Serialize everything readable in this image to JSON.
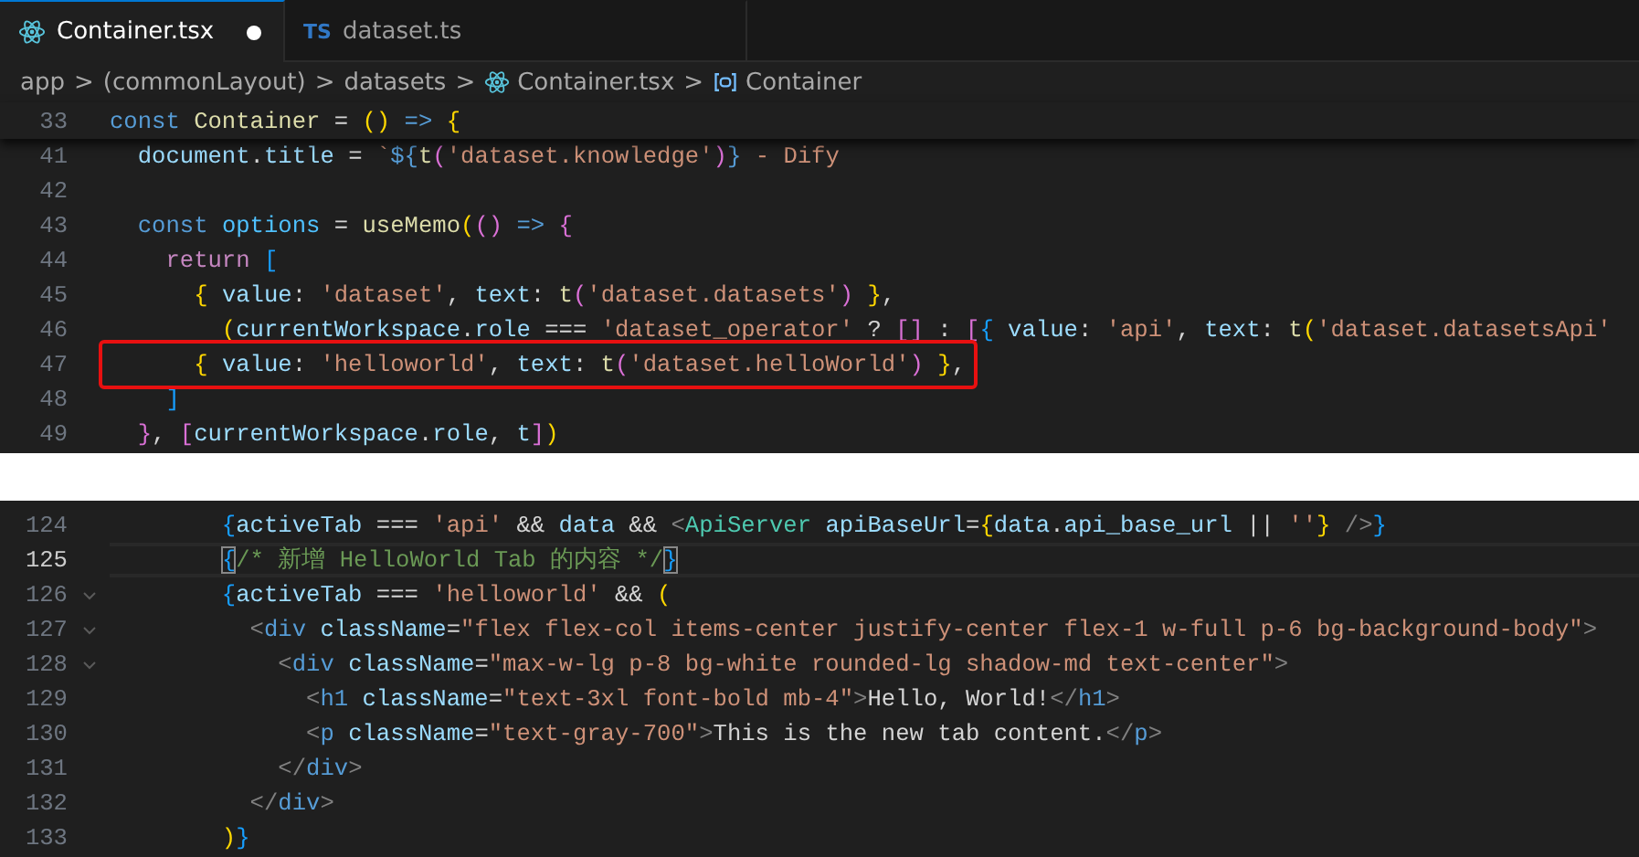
{
  "tabs": [
    {
      "kind": "tsx",
      "label": "Container.tsx",
      "selected": true,
      "modified": true
    },
    {
      "kind": "ts",
      "badge": "TS",
      "label": "dataset.ts",
      "selected": false,
      "modified": false
    }
  ],
  "breadcrumb": [
    {
      "kind": "folder",
      "label": "app"
    },
    {
      "kind": "folder",
      "sep": ">",
      "label": "(commonLayout)"
    },
    {
      "kind": "folder",
      "sep": ">",
      "label": "datasets"
    },
    {
      "kind": "file",
      "sep": ">",
      "label": "Container.tsx"
    },
    {
      "kind": "symbol",
      "sep": ">",
      "label": "Container"
    }
  ],
  "sticky_line": {
    "number": "33",
    "tokens": [
      {
        "kind": "kw",
        "text": "const "
      },
      {
        "kind": "fn",
        "text": "Container"
      },
      {
        "kind": "p",
        "text": " = "
      },
      {
        "kind": "b1",
        "text": "()"
      },
      {
        "kind": "kw",
        "text": " => "
      },
      {
        "kind": "b1",
        "text": "{"
      }
    ]
  },
  "editor_top": {
    "lines": [
      {
        "number": "41",
        "tokens": [
          {
            "kind": "var",
            "text": "  document"
          },
          {
            "kind": "p",
            "text": "."
          },
          {
            "kind": "var",
            "text": "title"
          },
          {
            "kind": "p",
            "text": " = "
          },
          {
            "kind": "str",
            "text": "`"
          },
          {
            "kind": "kw",
            "text": "${"
          },
          {
            "kind": "fn",
            "text": "t"
          },
          {
            "kind": "b2",
            "text": "("
          },
          {
            "kind": "str",
            "text": "'dataset.knowledge'"
          },
          {
            "kind": "b2",
            "text": ")"
          },
          {
            "kind": "kw",
            "text": "}"
          },
          {
            "kind": "str",
            "text": " - Dify"
          }
        ]
      },
      {
        "number": "42"
      },
      {
        "number": "43",
        "tokens": [
          {
            "kind": "kw",
            "text": "  const "
          },
          {
            "kind": "const",
            "text": "options"
          },
          {
            "kind": "p",
            "text": " = "
          },
          {
            "kind": "fn",
            "text": "useMemo"
          },
          {
            "kind": "b1",
            "text": "("
          },
          {
            "kind": "b2",
            "text": "()"
          },
          {
            "kind": "kw",
            "text": " => "
          },
          {
            "kind": "b2",
            "text": "{"
          }
        ]
      },
      {
        "number": "44",
        "tokens": [
          {
            "kind": "ctl",
            "text": "    return "
          },
          {
            "kind": "b3",
            "text": "["
          }
        ]
      },
      {
        "number": "45",
        "tokens": [
          {
            "kind": "b1",
            "text": "      {"
          },
          {
            "kind": "var",
            "text": " value"
          },
          {
            "kind": "p",
            "text": ": "
          },
          {
            "kind": "str",
            "text": "'dataset'"
          },
          {
            "kind": "p",
            "text": ", "
          },
          {
            "kind": "var",
            "text": "text"
          },
          {
            "kind": "p",
            "text": ": "
          },
          {
            "kind": "fn",
            "text": "t"
          },
          {
            "kind": "b2",
            "text": "("
          },
          {
            "kind": "str",
            "text": "'dataset.datasets'"
          },
          {
            "kind": "b2",
            "text": ")"
          },
          {
            "kind": "b1",
            "text": " }"
          },
          {
            "kind": "p",
            "text": ","
          }
        ]
      },
      {
        "number": "46",
        "tokens": [
          {
            "kind": "b1",
            "text": "        ("
          },
          {
            "kind": "var",
            "text": "currentWorkspace"
          },
          {
            "kind": "p",
            "text": "."
          },
          {
            "kind": "var",
            "text": "role"
          },
          {
            "kind": "p",
            "text": " === "
          },
          {
            "kind": "str",
            "text": "'dataset_operator'"
          },
          {
            "kind": "p",
            "text": " ? "
          },
          {
            "kind": "b2",
            "text": "[]"
          },
          {
            "kind": "p",
            "text": " : "
          },
          {
            "kind": "b2",
            "text": "["
          },
          {
            "kind": "b3",
            "text": "{"
          },
          {
            "kind": "var",
            "text": " value"
          },
          {
            "kind": "p",
            "text": ": "
          },
          {
            "kind": "str",
            "text": "'api'"
          },
          {
            "kind": "p",
            "text": ", "
          },
          {
            "kind": "var",
            "text": "text"
          },
          {
            "kind": "p",
            "text": ": "
          },
          {
            "kind": "fn",
            "text": "t"
          },
          {
            "kind": "b1",
            "text": "("
          },
          {
            "kind": "str",
            "text": "'dataset.datasetsApi'"
          }
        ]
      },
      {
        "number": "47",
        "highlighted": true,
        "tokens": [
          {
            "kind": "b1",
            "text": "      {"
          },
          {
            "kind": "var",
            "text": " value"
          },
          {
            "kind": "p",
            "text": ": "
          },
          {
            "kind": "str",
            "text": "'helloworld'"
          },
          {
            "kind": "p",
            "text": ", "
          },
          {
            "kind": "var",
            "text": "text"
          },
          {
            "kind": "p",
            "text": ": "
          },
          {
            "kind": "fn",
            "text": "t"
          },
          {
            "kind": "b2",
            "text": "("
          },
          {
            "kind": "str",
            "text": "'dataset.helloWorld'"
          },
          {
            "kind": "b2",
            "text": ")"
          },
          {
            "kind": "b1",
            "text": " }"
          },
          {
            "kind": "p",
            "text": ","
          }
        ]
      },
      {
        "number": "48",
        "tokens": [
          {
            "kind": "b3",
            "text": "    ]"
          }
        ]
      },
      {
        "number": "49",
        "tokens": [
          {
            "kind": "b2",
            "text": "  }"
          },
          {
            "kind": "p",
            "text": ", "
          },
          {
            "kind": "b2",
            "text": "["
          },
          {
            "kind": "var",
            "text": "currentWorkspace"
          },
          {
            "kind": "p",
            "text": "."
          },
          {
            "kind": "var",
            "text": "role"
          },
          {
            "kind": "p",
            "text": ", "
          },
          {
            "kind": "var",
            "text": "t"
          },
          {
            "kind": "b2",
            "text": "]"
          },
          {
            "kind": "b1",
            "text": ")"
          }
        ]
      }
    ]
  },
  "editor_bottom": {
    "lines": [
      {
        "number": "124",
        "tokens": [
          {
            "kind": "b3",
            "text": "        {"
          },
          {
            "kind": "var",
            "text": "activeTab"
          },
          {
            "kind": "p",
            "text": " === "
          },
          {
            "kind": "str",
            "text": "'api'"
          },
          {
            "kind": "p",
            "text": " && "
          },
          {
            "kind": "var",
            "text": "data"
          },
          {
            "kind": "p",
            "text": " && "
          },
          {
            "kind": "tag",
            "text": "<"
          },
          {
            "kind": "comp",
            "text": "ApiServer"
          },
          {
            "kind": "var",
            "text": " apiBaseUrl"
          },
          {
            "kind": "p",
            "text": "="
          },
          {
            "kind": "b1",
            "text": "{"
          },
          {
            "kind": "var",
            "text": "data"
          },
          {
            "kind": "p",
            "text": "."
          },
          {
            "kind": "var",
            "text": "api_base_url"
          },
          {
            "kind": "p",
            "text": " || "
          },
          {
            "kind": "str",
            "text": "''"
          },
          {
            "kind": "b1",
            "text": "}"
          },
          {
            "kind": "tag",
            "text": " />"
          },
          {
            "kind": "b3",
            "text": "}"
          }
        ]
      },
      {
        "number": "125",
        "current": true,
        "tokens": [
          {
            "kind": "bm",
            "text": "        {"
          },
          {
            "kind": "cm",
            "text": "/* 新增 HelloWorld Tab 的内容 */"
          },
          {
            "kind": "bm",
            "text": "}"
          }
        ]
      },
      {
        "number": "126",
        "foldable": true,
        "tokens": [
          {
            "kind": "b3",
            "text": "        {"
          },
          {
            "kind": "var",
            "text": "activeTab"
          },
          {
            "kind": "p",
            "text": " === "
          },
          {
            "kind": "str",
            "text": "'helloworld'"
          },
          {
            "kind": "p",
            "text": " && "
          },
          {
            "kind": "b1",
            "text": "("
          }
        ]
      },
      {
        "number": "127",
        "foldable": true,
        "tokens": [
          {
            "kind": "tag",
            "text": "          <"
          },
          {
            "kind": "tn",
            "text": "div"
          },
          {
            "kind": "var",
            "text": " className"
          },
          {
            "kind": "p",
            "text": "="
          },
          {
            "kind": "str",
            "text": "\"flex flex-col items-center justify-center flex-1 w-full p-6 bg-background-body\""
          },
          {
            "kind": "tag",
            "text": ">"
          }
        ]
      },
      {
        "number": "128",
        "foldable": true,
        "tokens": [
          {
            "kind": "tag",
            "text": "            <"
          },
          {
            "kind": "tn",
            "text": "div"
          },
          {
            "kind": "var",
            "text": " className"
          },
          {
            "kind": "p",
            "text": "="
          },
          {
            "kind": "str",
            "text": "\"max-w-lg p-8 bg-white rounded-lg shadow-md text-center\""
          },
          {
            "kind": "tag",
            "text": ">"
          }
        ]
      },
      {
        "number": "129",
        "tokens": [
          {
            "kind": "tag",
            "text": "              <"
          },
          {
            "kind": "tn",
            "text": "h1"
          },
          {
            "kind": "var",
            "text": " className"
          },
          {
            "kind": "p",
            "text": "="
          },
          {
            "kind": "str",
            "text": "\"text-3xl font-bold mb-4\""
          },
          {
            "kind": "tag",
            "text": ">"
          },
          {
            "kind": "txt",
            "text": "Hello, World!"
          },
          {
            "kind": "tag",
            "text": "</"
          },
          {
            "kind": "tn",
            "text": "h1"
          },
          {
            "kind": "tag",
            "text": ">"
          }
        ]
      },
      {
        "number": "130",
        "tokens": [
          {
            "kind": "tag",
            "text": "              <"
          },
          {
            "kind": "tn",
            "text": "p"
          },
          {
            "kind": "var",
            "text": " className"
          },
          {
            "kind": "p",
            "text": "="
          },
          {
            "kind": "str",
            "text": "\"text-gray-700\""
          },
          {
            "kind": "tag",
            "text": ">"
          },
          {
            "kind": "txt",
            "text": "This is the new tab content."
          },
          {
            "kind": "tag",
            "text": "</"
          },
          {
            "kind": "tn",
            "text": "p"
          },
          {
            "kind": "tag",
            "text": ">"
          }
        ]
      },
      {
        "number": "131",
        "tokens": [
          {
            "kind": "tag",
            "text": "            </"
          },
          {
            "kind": "tn",
            "text": "div"
          },
          {
            "kind": "tag",
            "text": ">"
          }
        ]
      },
      {
        "number": "132",
        "tokens": [
          {
            "kind": "tag",
            "text": "          </"
          },
          {
            "kind": "tn",
            "text": "div"
          },
          {
            "kind": "tag",
            "text": ">"
          }
        ]
      },
      {
        "number": "133",
        "tokens": [
          {
            "kind": "b1",
            "text": "        )"
          },
          {
            "kind": "b3",
            "text": "}"
          }
        ]
      }
    ]
  }
}
